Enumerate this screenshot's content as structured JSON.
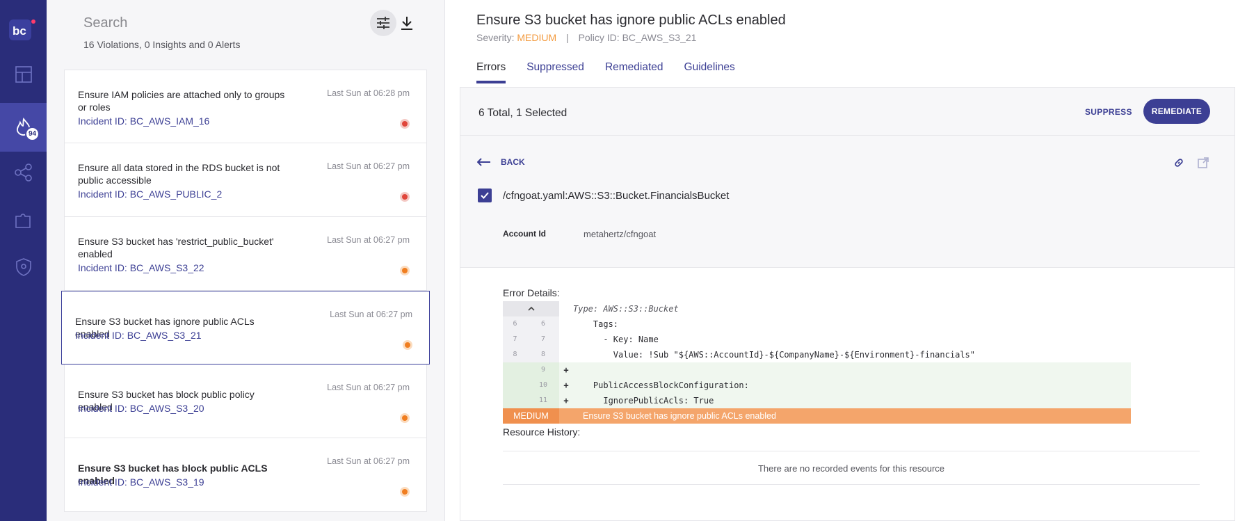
{
  "nav": {
    "badge_count": "94",
    "items": [
      "dashboard",
      "incidents",
      "graph",
      "integrations",
      "shield"
    ]
  },
  "list": {
    "search_placeholder": "Search",
    "summary": "16 Violations, 0 Insights and 0 Alerts",
    "cards": [
      {
        "title": "Ensure IAM policies are attached only to groups or roles",
        "incident": "Incident ID: BC_AWS_IAM_16",
        "time": "Last Sun at 06:28 pm",
        "severity": "high",
        "bold": false
      },
      {
        "title": "Ensure all data stored in the RDS bucket is not public accessible",
        "incident": "Incident ID: BC_AWS_PUBLIC_2",
        "time": "Last Sun at 06:27 pm",
        "severity": "high",
        "bold": false
      },
      {
        "title": "Ensure S3 bucket has 'restrict_public_bucket' enabled",
        "incident": "Incident ID: BC_AWS_S3_22",
        "time": "Last Sun at 06:27 pm",
        "severity": "medium",
        "bold": false
      },
      {
        "title": "Ensure S3 bucket has ignore public ACLs enabled",
        "incident": "Incident ID: BC_AWS_S3_21",
        "time": "Last Sun at 06:27 pm",
        "severity": "medium",
        "bold": false
      },
      {
        "title": "Ensure S3 bucket has block public policy enabled",
        "incident": "Incident ID: BC_AWS_S3_20",
        "time": "Last Sun at 06:27 pm",
        "severity": "medium",
        "bold": false
      },
      {
        "title": "Ensure S3 bucket has block public ACLS enabled",
        "incident": "Incident ID: BC_AWS_S3_19",
        "time": "Last Sun at 06:27 pm",
        "severity": "medium",
        "bold": true
      }
    ]
  },
  "detail": {
    "title": "Ensure S3 bucket has ignore public ACLs enabled",
    "severity_label": "Severity:",
    "severity_value": "MEDIUM",
    "policy_id": "Policy ID: BC_AWS_S3_21",
    "tabs": [
      "Errors",
      "Suppressed",
      "Remediated",
      "Guidelines"
    ],
    "total_selected": "6 Total, 1 Selected",
    "suppress_label": "SUPPRESS",
    "remediate_label": "REMEDIATE",
    "back_label": "BACK",
    "resource_path": "/cfngoat.yaml:AWS::S3::Bucket.FinancialsBucket",
    "account_label": "Account Id",
    "account_value": "metahertz/cfngoat",
    "error_details_label": "Error Details:",
    "code_header": "Type: AWS::S3::Bucket",
    "code_lines": [
      {
        "old": "6",
        "new": "6",
        "sign": "",
        "text": "    Tags:",
        "added": false
      },
      {
        "old": "7",
        "new": "7",
        "sign": "",
        "text": "      - Key: Name",
        "added": false
      },
      {
        "old": "8",
        "new": "8",
        "sign": "",
        "text": "        Value: !Sub \"${AWS::AccountId}-${CompanyName}-${Environment}-financials\"",
        "added": false
      },
      {
        "old": "",
        "new": "9",
        "sign": "+",
        "text": "",
        "added": true
      },
      {
        "old": "",
        "new": "10",
        "sign": "+",
        "text": "    PublicAccessBlockConfiguration:",
        "added": true
      },
      {
        "old": "",
        "new": "11",
        "sign": "+",
        "text": "      IgnorePublicAcls: True",
        "added": true
      }
    ],
    "sev_bar_label": "MEDIUM",
    "sev_bar_message": "Ensure S3 bucket has ignore public ACLs enabled",
    "resource_history_label": "Resource History:",
    "no_events": "There are no recorded events for this resource"
  },
  "colors": {
    "nav_bg": "#2a2d7a",
    "accent": "#3c3f94",
    "medium": "#f39a3e",
    "high": "#e0463b"
  }
}
